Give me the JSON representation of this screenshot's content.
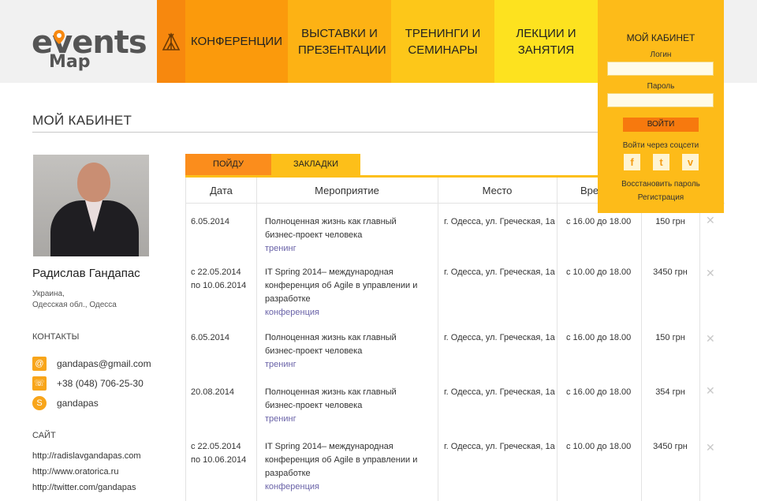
{
  "logo": {
    "word1": "events",
    "word2": "Map"
  },
  "nav": [
    {
      "label": "Конференции"
    },
    {
      "label": "Выставки и презентации"
    },
    {
      "label": "Тренинги и семинары"
    },
    {
      "label": "Лекции и занятия"
    }
  ],
  "login": {
    "title": "Мой кабинет",
    "login_label": "Логин",
    "password_label": "Пароль",
    "submit": "Войти",
    "social_title": "Войти через соцсети",
    "social": [
      "f",
      "t",
      "v"
    ],
    "restore": "Восстановить пароль",
    "register": "Регистрация"
  },
  "page_title": "Мой кабинет",
  "profile": {
    "name": "Радислав Гандапас",
    "country": "Украина,",
    "region": "Одесская обл., Одесса",
    "contacts_title": "Контакты",
    "email": "gandapas@gmail.com",
    "phone": "+38 (048) 706-25-30",
    "skype": "gandapas",
    "site_title": "Сайт",
    "sites": [
      "http://radislavgandapas.com",
      "http://www.oratorica.ru",
      "http://twitter.com/gandapas"
    ]
  },
  "tabs": {
    "going": "Пойду",
    "bookmarks": "Закладки"
  },
  "table": {
    "headers": [
      "Дата",
      "Мероприятие",
      "Место",
      "Время"
    ],
    "rows": [
      {
        "date1": "6.05.2014",
        "date2": "",
        "event": [
          "Полноценная жизнь как главный",
          "бизнес-проект человека",
          ""
        ],
        "tag": "тренинг",
        "place": "г. Одесса, ул. Греческая, 1а",
        "time": "с 16.00 до 18.00",
        "price": "150 грн"
      },
      {
        "date1": "с 22.05.2014",
        "date2": "по 10.06.2014",
        "event": [
          "IT Spring 2014– международная",
          "конференция об Agile в управлении и",
          "разработке"
        ],
        "tag": "конференция",
        "place": "г. Одесса, ул. Греческая, 1а",
        "time": "с 10.00 до 18.00",
        "price": "3450 грн"
      },
      {
        "date1": "6.05.2014",
        "date2": "",
        "event": [
          "Полноценная жизнь как главный",
          "бизнес-проект человека",
          ""
        ],
        "tag": "тренинг",
        "place": "г. Одесса, ул. Греческая, 1а",
        "time": "с 16.00 до 18.00",
        "price": "150 грн"
      },
      {
        "date1": "20.08.2014",
        "date2": "",
        "event": [
          "Полноценная жизнь как главный",
          "бизнес-проект человека",
          ""
        ],
        "tag": "тренинг",
        "place": "г. Одесса, ул. Греческая, 1а",
        "time": "с 16.00 до 18.00",
        "price": "354 грн"
      },
      {
        "date1": "с 22.05.2014",
        "date2": "по 10.06.2014",
        "event": [
          "IT Spring 2014– международная",
          "конференция об Agile в управлении и",
          "разработке"
        ],
        "tag": "конференция",
        "place": "г. Одесса, ул. Греческая, 1а",
        "time": "с 10.00 до 18.00",
        "price": "3450 грн"
      }
    ]
  },
  "colors": {
    "accent": "#fb9a0c",
    "tag": "#6a63a8",
    "login_bg": "#fdbb19"
  }
}
